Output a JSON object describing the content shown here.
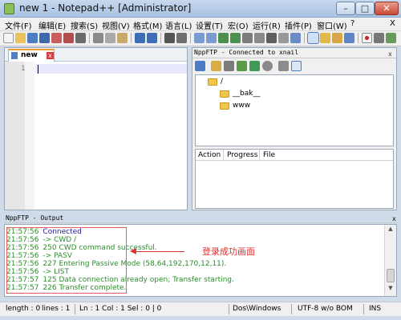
{
  "window": {
    "title": "new  1 - Notepad++ [Administrator]",
    "controls": {
      "minimize": "–",
      "maximize": "□",
      "close": "✕"
    }
  },
  "menu": [
    "文件(F)",
    "编辑(E)",
    "搜索(S)",
    "视图(V)",
    "格式(M)",
    "语言(L)",
    "设置(T)",
    "宏(O)",
    "运行(R)",
    "插件(P)",
    "窗口(W)",
    "?"
  ],
  "menu_close": "X",
  "editor": {
    "tab_label": "new",
    "tab_close": "x",
    "line_number": "1"
  },
  "nppftp": {
    "title": "NppFTP - Connected to xnail",
    "close": "x",
    "tree": {
      "root": "/",
      "children": [
        "__bak__",
        "www"
      ]
    },
    "queue_columns": [
      "Action",
      "Progress",
      "File"
    ]
  },
  "output": {
    "title": "NppFTP - Output",
    "close": "x",
    "lines": [
      {
        "time": "21:57:56",
        "text": "Connected",
        "color": "#1a1aa0"
      },
      {
        "time": "21:57:56",
        "text": "-> CWD /",
        "color": "#2a8f2a"
      },
      {
        "time": "21:57:56",
        "text": "250 CWD command successful.",
        "color": "#2a8f2a"
      },
      {
        "time": "21:57:56",
        "text": "-> PASV",
        "color": "#2a8f2a"
      },
      {
        "time": "21:57:56",
        "text": "227 Entering Passive Mode (58,64,192,170,12,11).",
        "color": "#2a8f2a"
      },
      {
        "time": "21:57:56",
        "text": "-> LIST",
        "color": "#2a8f2a"
      },
      {
        "time": "21:57:57",
        "text": "125 Data connection already open; Transfer starting.",
        "color": "#2a8f2a"
      },
      {
        "time": "21:57:57",
        "text": "226 Transfer complete.",
        "color": "#2a8f2a"
      }
    ],
    "annotation": "登录成功画面"
  },
  "statusbar": {
    "length": "length : 0",
    "lines": "lines : 1",
    "position": "Ln : 1    Col : 1    Sel : 0 | 0",
    "eol": "Dos\\Windows",
    "encoding": "UTF-8 w/o BOM",
    "mode": "INS"
  },
  "colors": {
    "log_time": "#2a8f2a",
    "annotation": "#e03030",
    "accent": "#4d7cc4"
  }
}
